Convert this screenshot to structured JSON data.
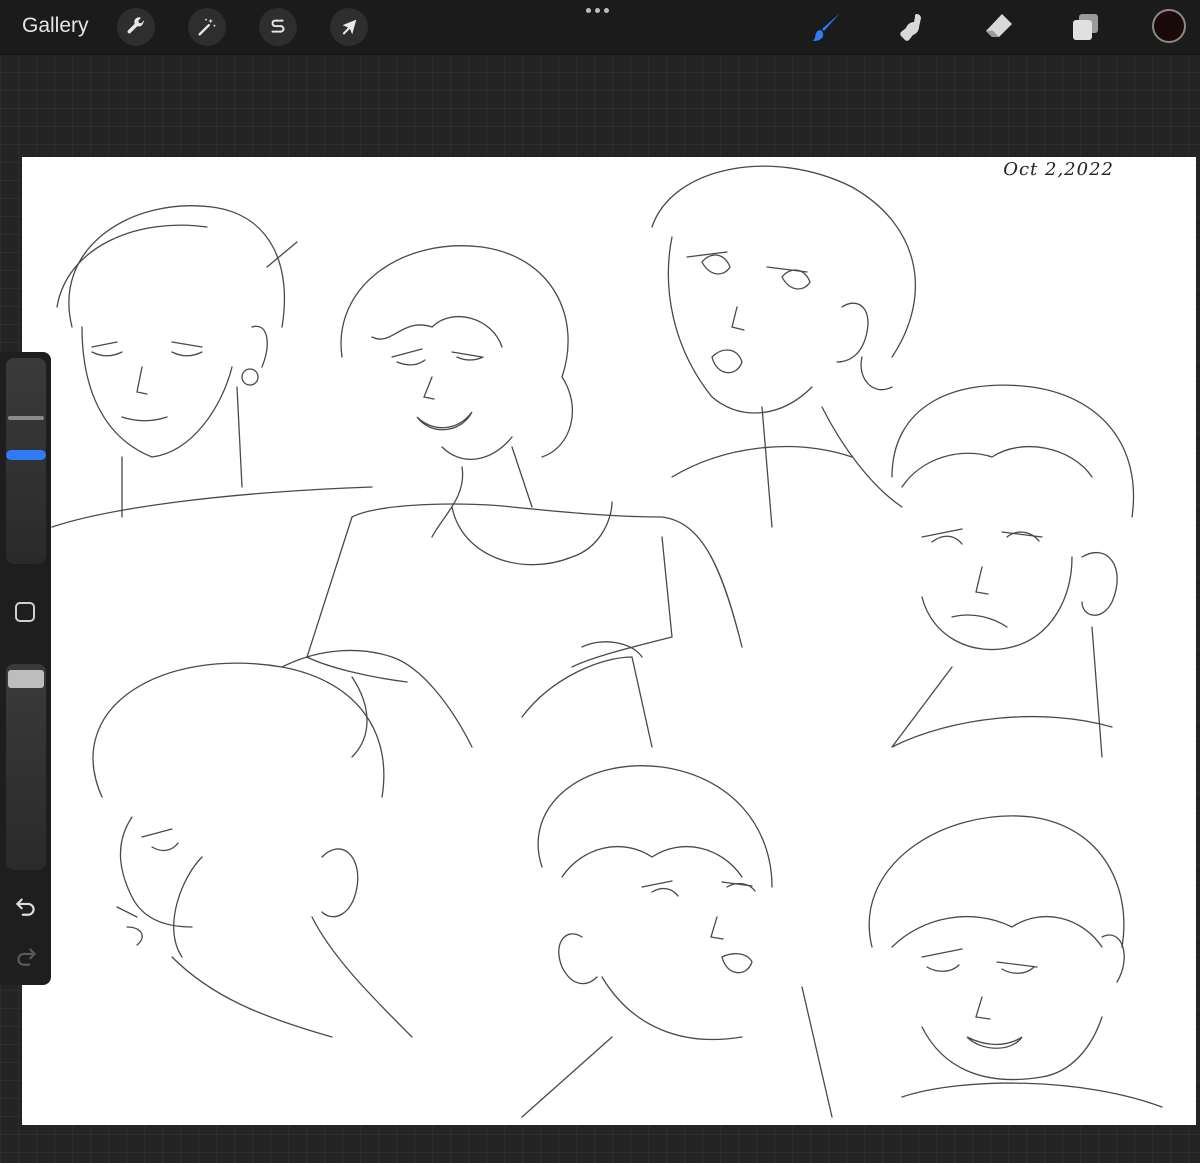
{
  "toolbar": {
    "gallery_label": "Gallery",
    "left_tools": [
      {
        "name": "actions",
        "icon": "wrench-icon"
      },
      {
        "name": "adjustments",
        "icon": "magic-wand-icon"
      },
      {
        "name": "selection",
        "icon": "selection-s-icon"
      },
      {
        "name": "transform",
        "icon": "arrow-cursor-icon"
      }
    ],
    "more_icon": "more-dots-icon",
    "right_tools": [
      {
        "name": "brush",
        "icon": "brush-icon",
        "active": true,
        "color": "#2f7bf5"
      },
      {
        "name": "smudge",
        "icon": "smudge-finger-icon"
      },
      {
        "name": "eraser",
        "icon": "eraser-icon"
      },
      {
        "name": "layers",
        "icon": "layers-icon"
      }
    ],
    "current_color": "#1a0a0a"
  },
  "canvas": {
    "date_text": "Oct 2,2022",
    "background": "#ffffff"
  },
  "sidebar": {
    "brush_size_icon": "brush-size-slider",
    "modify_icon": "modify-square-icon",
    "opacity_icon": "opacity-slider",
    "undo_icon": "undo-arrow-icon",
    "redo_icon": "redo-arrow-icon",
    "accent": "#2f7bf5"
  }
}
